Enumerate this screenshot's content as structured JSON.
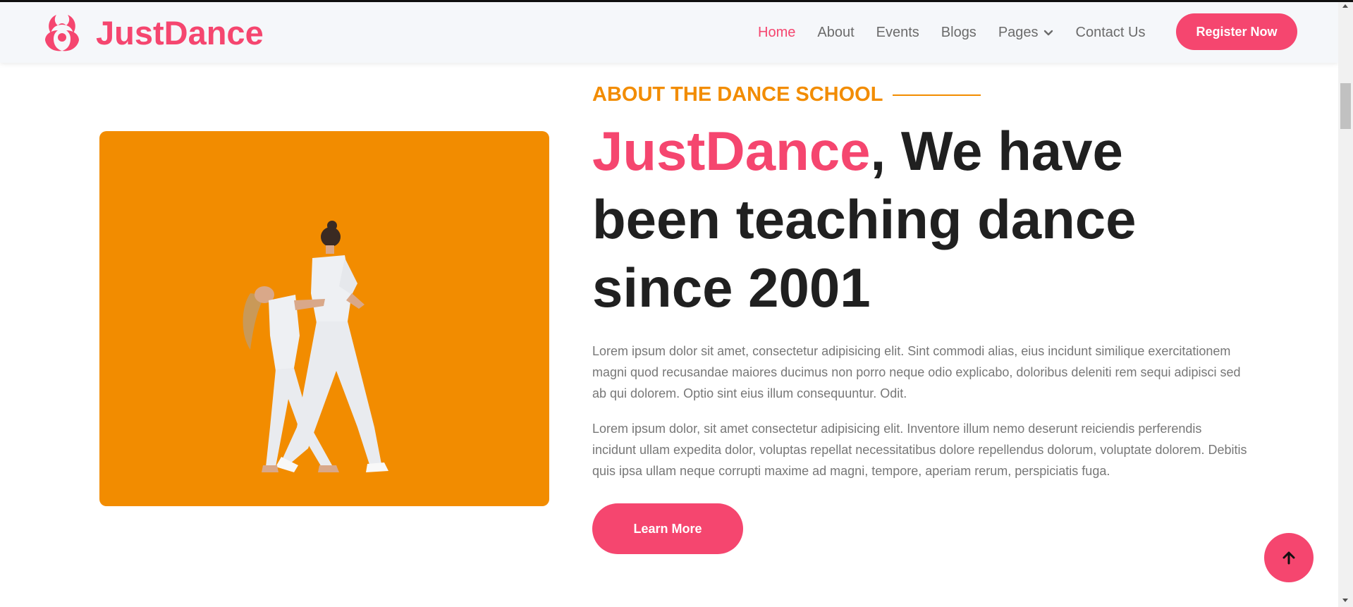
{
  "header": {
    "brand_name": "JustDance",
    "logo_icon": "biohazard-icon",
    "nav": [
      {
        "label": "Home",
        "active": true
      },
      {
        "label": "About",
        "active": false
      },
      {
        "label": "Events",
        "active": false
      },
      {
        "label": "Blogs",
        "active": false
      },
      {
        "label": "Pages",
        "active": false,
        "icon": "chevron-down-icon"
      },
      {
        "label": "Contact Us",
        "active": false
      }
    ],
    "register_label": "Register Now"
  },
  "about": {
    "eyebrow": "ABOUT THE DANCE SCHOOL",
    "headline_brand": "JustDance",
    "headline_rest": ", We have been teaching dance since 2001",
    "paragraph_1": "Lorem ipsum dolor sit amet, consectetur adipisicing elit. Sint commodi alias, eius incidunt similique exercitationem magni quod recusandae maiores ducimus non porro neque odio explicabo, doloribus deleniti rem sequi adipisci sed ab qui dolorem. Optio sint eius illum consequuntur. Odit.",
    "paragraph_2": "Lorem ipsum dolor, sit amet consectetur adipisicing elit. Inventore illum nemo deserunt reiciendis perferendis incidunt ullam expedita dolor, voluptas repellat necessitatibus dolore repellendus dolorum, voluptate dolorem. Debitis quis ipsa ullam neque corrupti maxime ad magni, tempore, aperiam rerum, perspiciatis fuga.",
    "cta_label": "Learn More"
  },
  "colors": {
    "accent": "#f5466f",
    "secondary": "#f28c00",
    "heading": "#202020",
    "body_text": "#777777"
  }
}
